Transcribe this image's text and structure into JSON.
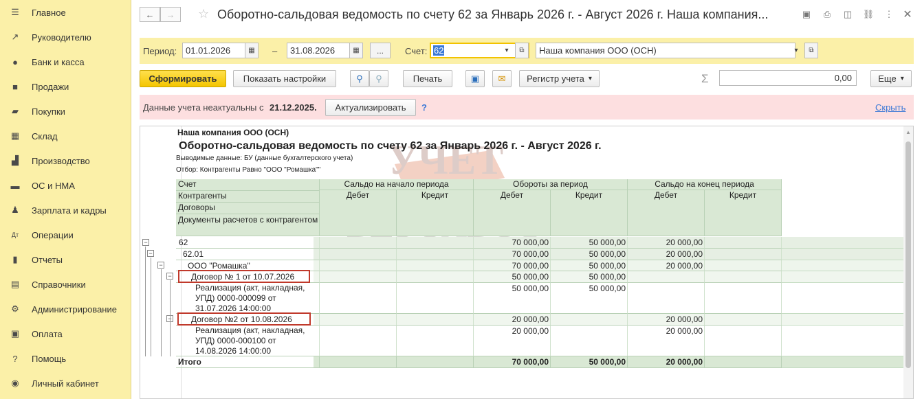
{
  "sidebar": {
    "items": [
      {
        "label": "Главное",
        "icon": "menu-icon"
      },
      {
        "label": "Руководителю",
        "icon": "trend-icon"
      },
      {
        "label": "Банк и касса",
        "icon": "coin-icon"
      },
      {
        "label": "Продажи",
        "icon": "bag-icon"
      },
      {
        "label": "Покупки",
        "icon": "cart-icon"
      },
      {
        "label": "Склад",
        "icon": "warehouse-icon"
      },
      {
        "label": "Производство",
        "icon": "factory-icon"
      },
      {
        "label": "ОС и НМА",
        "icon": "truck-icon"
      },
      {
        "label": "Зарплата и кадры",
        "icon": "person-icon"
      },
      {
        "label": "Операции",
        "icon": "operations-icon"
      },
      {
        "label": "Отчеты",
        "icon": "bar-chart-icon"
      },
      {
        "label": "Справочники",
        "icon": "books-icon"
      },
      {
        "label": "Администрирование",
        "icon": "gear-icon"
      },
      {
        "label": "Оплата",
        "icon": "payment-icon"
      },
      {
        "label": "Помощь",
        "icon": "question-icon"
      },
      {
        "label": "Личный кабинет",
        "icon": "user-circle-icon"
      }
    ]
  },
  "window": {
    "title": "Оборотно-сальдовая ведомость по счету 62 за Январь 2026 г. - Август 2026 г. Наша компания..."
  },
  "filters": {
    "period_label": "Период:",
    "date_from": "01.01.2026",
    "dash": "–",
    "date_to": "31.08.2026",
    "ellipsis": "...",
    "account_label": "Счет:",
    "account_value": "62",
    "organization": "Наша компания ООО (ОСН)"
  },
  "toolbar": {
    "generate": "Сформировать",
    "show_settings": "Показать настройки",
    "print": "Печать",
    "register": "Регистр учета",
    "sum_symbol": "Σ",
    "sum_value": "0,00",
    "more": "Еще"
  },
  "warning": {
    "text_prefix": "Данные учета неактуальны с",
    "date": "21.12.2025.",
    "update_button": "Актуализировать",
    "help": "?",
    "hide_link": "Скрыть"
  },
  "report": {
    "company": "Наша компания ООО (ОСН)",
    "heading": "Оборотно-сальдовая ведомость по счету 62 за Январь 2026 г. - Август 2026 г.",
    "output_data": "Выводимые данные: БУ (данные бухгалтерского учета)",
    "filter": "Отбор: Контрагенты Равно \"ООО \"Ромашка\"\"",
    "headers": {
      "account": "Счет",
      "counterparties": "Контрагенты",
      "contracts": "Договоры",
      "settlement_docs": "Документы расчетов с контрагентом",
      "opening": "Сальдо на начало периода",
      "turnover": "Обороты за период",
      "closing": "Сальдо на конец периода",
      "debit": "Дебет",
      "credit": "Кредит"
    },
    "rows": [
      {
        "name": "62",
        "open_d": "",
        "open_c": "",
        "turn_d": "70 000,00",
        "turn_c": "50 000,00",
        "close_d": "20 000,00",
        "close_c": ""
      },
      {
        "name": "62.01",
        "open_d": "",
        "open_c": "",
        "turn_d": "70 000,00",
        "turn_c": "50 000,00",
        "close_d": "20 000,00",
        "close_c": ""
      },
      {
        "name": "ООО \"Ромашка\"",
        "open_d": "",
        "open_c": "",
        "turn_d": "70 000,00",
        "turn_c": "50 000,00",
        "close_d": "20 000,00",
        "close_c": ""
      },
      {
        "name": "Договор № 1 от 10.07.2026",
        "open_d": "",
        "open_c": "",
        "turn_d": "50 000,00",
        "turn_c": "50 000,00",
        "close_d": "",
        "close_c": ""
      },
      {
        "name": "Реализация (акт, накладная, УПД) 0000-000099 от 31.07.2026 14:00:00",
        "open_d": "",
        "open_c": "",
        "turn_d": "50 000,00",
        "turn_c": "50 000,00",
        "close_d": "",
        "close_c": ""
      },
      {
        "name": "Договор №2 от 10.08.2026",
        "open_d": "",
        "open_c": "",
        "turn_d": "20 000,00",
        "turn_c": "",
        "close_d": "20 000,00",
        "close_c": ""
      },
      {
        "name": "Реализация (акт, накладная, УПД) 0000-000100 от 14.08.2026 14:00:00",
        "open_d": "",
        "open_c": "",
        "turn_d": "20 000,00",
        "turn_c": "",
        "close_d": "20 000,00",
        "close_c": ""
      }
    ],
    "total": {
      "name": "Итого",
      "turn_d": "70 000,00",
      "turn_c": "50 000,00",
      "close_d": "20 000,00"
    },
    "watermark_top": "УЧЕТ",
    "watermark_bottom": "БЕЗ ЗАБОТ"
  }
}
